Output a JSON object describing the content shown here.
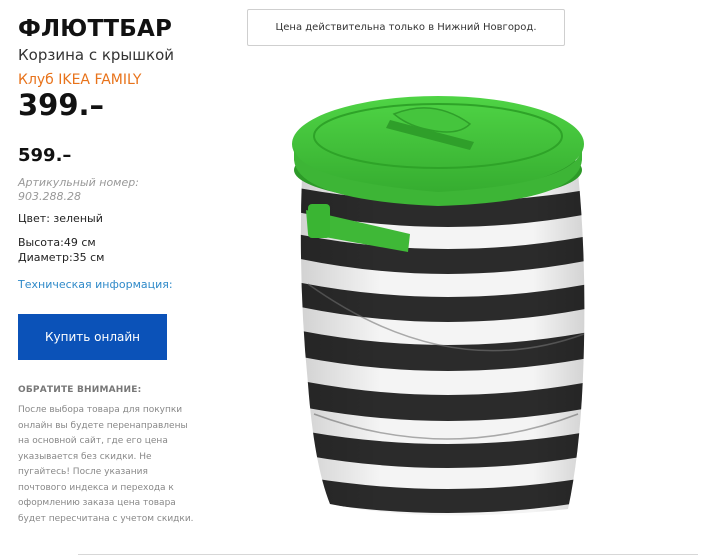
{
  "product": {
    "name": "ФЛЮТТБАР",
    "subtitle": "Корзина с крышкой",
    "family_label": "Клуб IKEA FAMILY",
    "family_price": "399.–",
    "regular_price": "599.–",
    "article": "Артикульный номер: 903.288.28",
    "color": "Цвет: зеленый",
    "height": "Высота:49 см",
    "diameter": "Диаметр:35 см",
    "tech_info_link": "Техническая информация:",
    "image_alt": "product-photo"
  },
  "actions": {
    "buy_online": "Купить онлайн"
  },
  "notice_box": {
    "text": "Цена действительна только в Нижний Новгород."
  },
  "note": {
    "heading": "ОБРАТИТЕ ВНИМАНИЕ:",
    "body": "После выбора товара для покупки онлайн вы будете перенаправлены на основной сайт, где его цена указывается без скидки. Не пугайтесь! После указания почтового индекса и перехода к оформлению заказа цена товара будет пересчитана с учетом скидки."
  },
  "colors": {
    "accent_orange": "#e8731b",
    "link_blue": "#2f8ac9",
    "button_blue": "#0b52b8",
    "lid_green": "#43c23a",
    "stripe_dark": "#2b2b2b"
  }
}
